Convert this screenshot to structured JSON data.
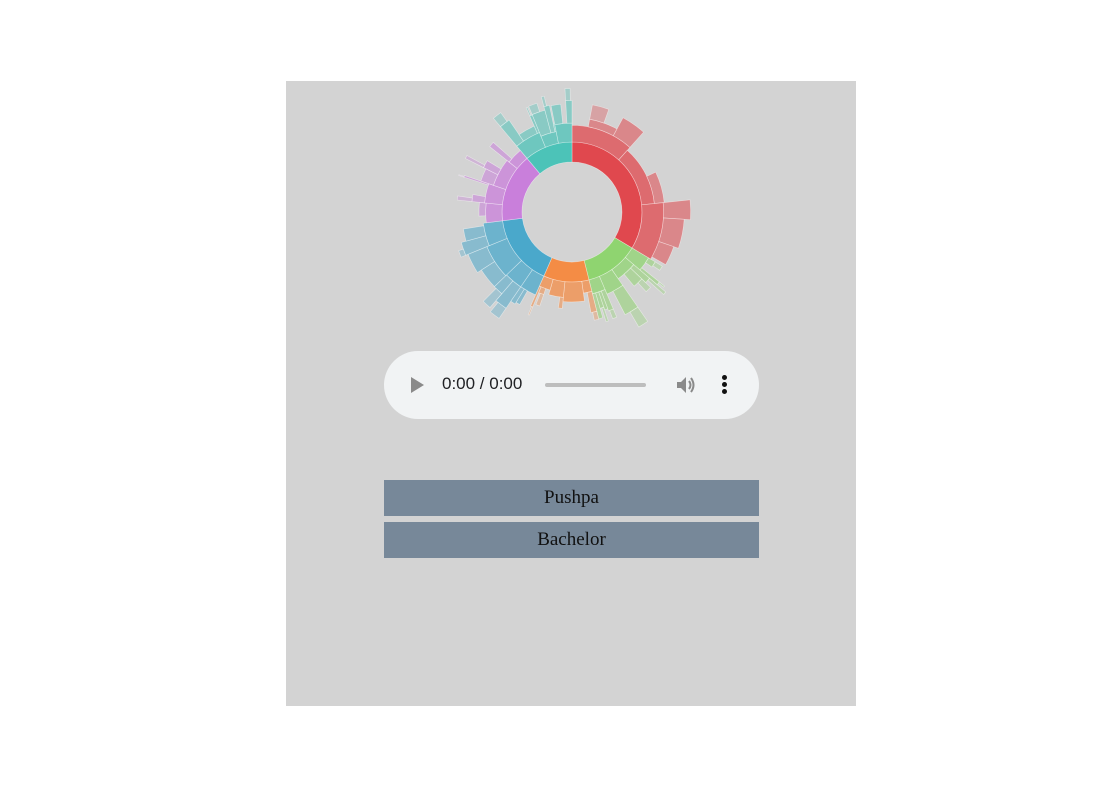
{
  "player": {
    "time_label": "0:00 / 0:00",
    "progress": 0
  },
  "songs": [
    "Pushpa",
    "Bachelor"
  ],
  "chart_data": {
    "type": "sunburst",
    "inner_ring": [
      {
        "color": "#e0484e",
        "share": 0.336
      },
      {
        "color": "#8fd470",
        "share": 0.125
      },
      {
        "color": "#f48c45",
        "share": 0.105
      },
      {
        "color": "#4aa8cb",
        "share": 0.164
      },
      {
        "color": "#c97fdb",
        "share": 0.159
      },
      {
        "color": "#4cc3b8",
        "share": 0.111
      }
    ]
  }
}
